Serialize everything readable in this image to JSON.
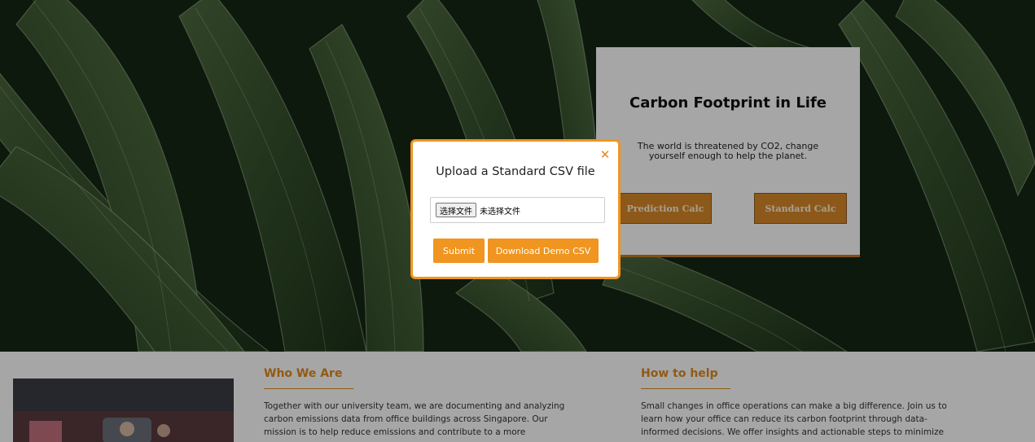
{
  "hero": {
    "card": {
      "title": "Carbon Footprint in Life",
      "text": "The world is threatened by CO2, change yourself enough to help the planet.",
      "prediction_btn": "Prediction Calc",
      "standard_btn": "Standard Calc"
    }
  },
  "info": {
    "who": {
      "title": "Who We Are",
      "text": "Together with our university team, we are documenting and analyzing carbon emissions data from office buildings across Singapore. Our mission is to help reduce emissions and contribute to a more"
    },
    "how": {
      "title": "How to help",
      "text": "Small changes in office operations can make a big difference. Join us to learn how your office can reduce its carbon footprint through data-informed decisions. We offer insights and actionable steps to minimize"
    }
  },
  "modal": {
    "title": "Upload a Standard CSV file",
    "close_symbol": "✕",
    "file_button": "选择文件",
    "file_status": "未选择文件",
    "submit": "Submit",
    "download": "Download Demo CSV"
  },
  "colors": {
    "accent": "#f0951f",
    "heading_orange": "#e08a1e",
    "leaf_dark": "#1f3a1f",
    "calc_button": "#d9892a"
  }
}
